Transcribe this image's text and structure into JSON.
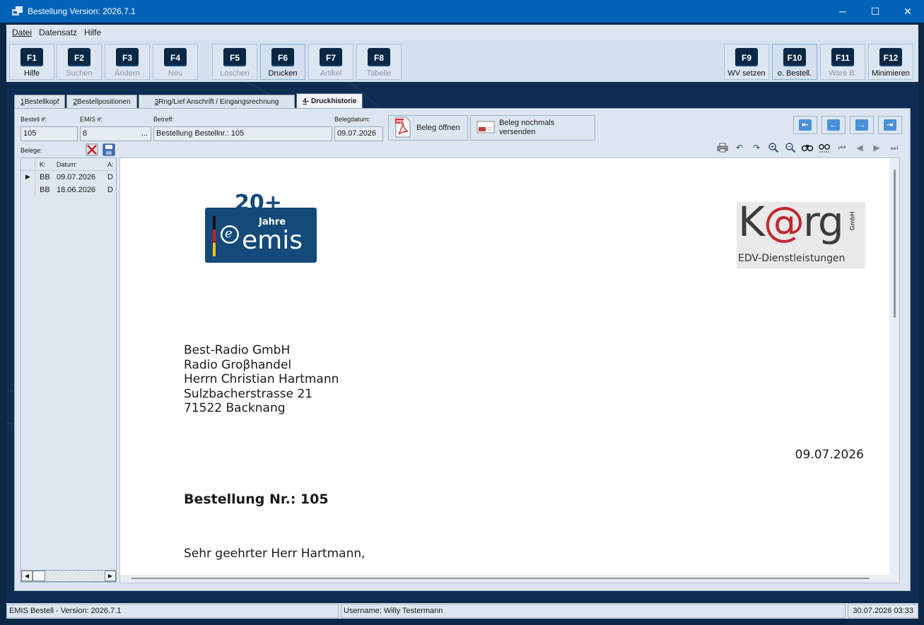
{
  "window": {
    "title": "Bestellung Version: 2026.7.1",
    "controls": {
      "minimize": "─",
      "maximize": "☐",
      "close": "✕"
    }
  },
  "menu": {
    "items": [
      "Datei",
      "Datensatz",
      "Hilfe"
    ]
  },
  "toolbar": {
    "keys": [
      {
        "key": "F1",
        "label": "Hilfe"
      },
      {
        "key": "F2",
        "label": "Suchen"
      },
      {
        "key": "F3",
        "label": "Ändern"
      },
      {
        "key": "F4",
        "label": "Neu"
      },
      {
        "key": "F5",
        "label": "Löschen"
      },
      {
        "key": "F6",
        "label": "Drucken"
      },
      {
        "key": "F7",
        "label": "Artikel"
      },
      {
        "key": "F8",
        "label": "Tabelle"
      },
      {
        "key": "F9",
        "label": "WV setzen"
      },
      {
        "key": "F10",
        "label": "o. Bestell."
      },
      {
        "key": "F11",
        "label": "Ware B."
      },
      {
        "key": "F12",
        "label": "Minimieren"
      }
    ]
  },
  "tabs": [
    {
      "num": "1",
      "label": " Bestellkopf"
    },
    {
      "num": "2",
      "label": " Bestellpositionen"
    },
    {
      "num": "3",
      "label": " Rng/Lief Anschrift / Eingangsrechnung"
    },
    {
      "num": "4",
      "label": " - Druckhistorie"
    }
  ],
  "form": {
    "bestell_label": "Bestell #:",
    "bestell_value": "105",
    "emis_label": "EMIS #:",
    "emis_value": "8",
    "emis_button": "...",
    "betreff_label": "Betreff:",
    "betreff_value": "Bestellung Bestellnr.: 105",
    "belegdatum_label": "Belegdatum:",
    "belegdatum_value": "09.07.2026",
    "open_button": "Beleg öffnen",
    "resend_button_line1": "Beleg nochmals",
    "resend_button_line2": "versenden",
    "belege_label": "Belege:"
  },
  "list": {
    "columns": [
      "K:",
      "Datum:",
      "A:"
    ],
    "rows": [
      {
        "k": "BB",
        "datum": "09.07.2026",
        "a": "D",
        "current": "▶"
      },
      {
        "k": "BB",
        "datum": "18.06.2026",
        "a": "D",
        "current": ""
      }
    ]
  },
  "document": {
    "emis_logo": {
      "top": "20+",
      "middle": "Jahre",
      "brand": "emis",
      "badge": "e"
    },
    "karg_logo": {
      "name": "K@rg",
      "suffix": "GmbH",
      "tagline": "EDV-Dienstleistungen"
    },
    "address": [
      "Best-Radio GmbH",
      "Radio Groβhandel",
      "Herrn Christian Hartmann",
      "Sulzbacherstrasse 21",
      "71522 Backnang"
    ],
    "date": "09.07.2026",
    "subject": "Bestellung Nr.: 105",
    "salutation": "Sehr geehrter Herr Hartmann,"
  },
  "status": {
    "version": "EMIS Bestell - Version: 2026.7.1",
    "user": "Username: Willy Testermann",
    "datetime": "30.07.2026 03:33"
  },
  "colors": {
    "titlebar": "#0163b8",
    "brand_dark": "#0a2745",
    "emis_blue": "#134a7a",
    "karg_red": "#c0282d"
  }
}
